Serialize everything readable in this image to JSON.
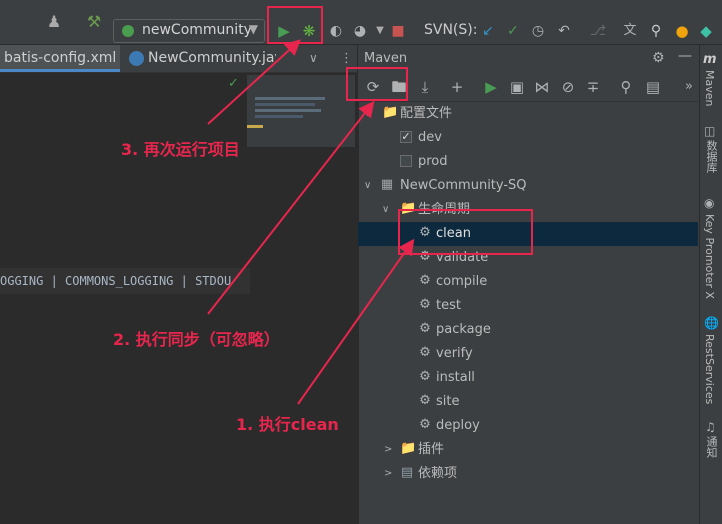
{
  "toolbar": {
    "run_config": "newCommunity",
    "svn_label": "SVN(S):"
  },
  "editor": {
    "tabs": [
      "batis-config.xml",
      "NewCommunity.java"
    ],
    "console_text": "OGGING | COMMONS_LOGGING | STDOU"
  },
  "maven": {
    "title": "Maven",
    "profiles_label": "配置文件",
    "profiles": [
      {
        "label": "dev",
        "checked": true
      },
      {
        "label": "prod",
        "checked": false
      }
    ],
    "project": "NewCommunity-SQ",
    "lifecycle_label": "生命周期",
    "lifecycle": [
      "clean",
      "validate",
      "compile",
      "test",
      "package",
      "verify",
      "install",
      "site",
      "deploy"
    ],
    "plugins_label": "插件",
    "deps_label": "依赖项"
  },
  "side_strip": [
    "Maven",
    "数据库",
    "Key Promoter X",
    "RestServices",
    "通知"
  ],
  "annotations": {
    "step1": "1. 执行clean",
    "step2": "2. 执行同步（可忽略）",
    "step3": "3. 再次运行项目"
  },
  "colors": {
    "annotation": "#e8264d",
    "run_green": "#499c54",
    "selection": "#0d293e"
  }
}
